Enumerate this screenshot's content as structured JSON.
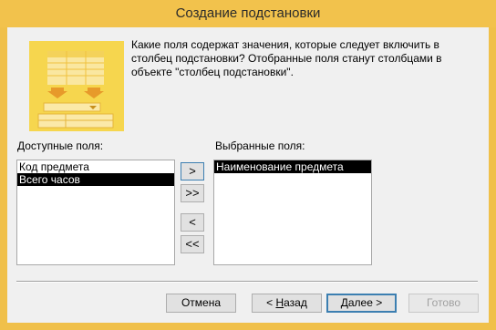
{
  "window": {
    "title": "Создание подстановки"
  },
  "description": "Какие поля содержат значения, которые следует включить в столбец подстановки? Отобранные поля станут столбцами в объекте \"столбец подстановки\".",
  "available": {
    "label": "Доступные поля:",
    "items": [
      "Код предмета",
      "Всего часов"
    ],
    "selected_index": 1
  },
  "selected": {
    "label": "Выбранные поля:",
    "items": [
      "Наименование предмета"
    ],
    "selected_index": 0
  },
  "move_buttons": {
    "add_one": ">",
    "add_all": ">>",
    "remove_one": "<",
    "remove_all": "<<"
  },
  "footer": {
    "cancel": "Отмена",
    "back_prefix": "< ",
    "back_accel": "Н",
    "back_rest": "азад",
    "next_accel": "Д",
    "next_rest": "алее >",
    "finish": "Готово"
  },
  "colors": {
    "titlebar": "#f2c24c",
    "illustration": "#f6d64e",
    "selection": "#000000"
  }
}
